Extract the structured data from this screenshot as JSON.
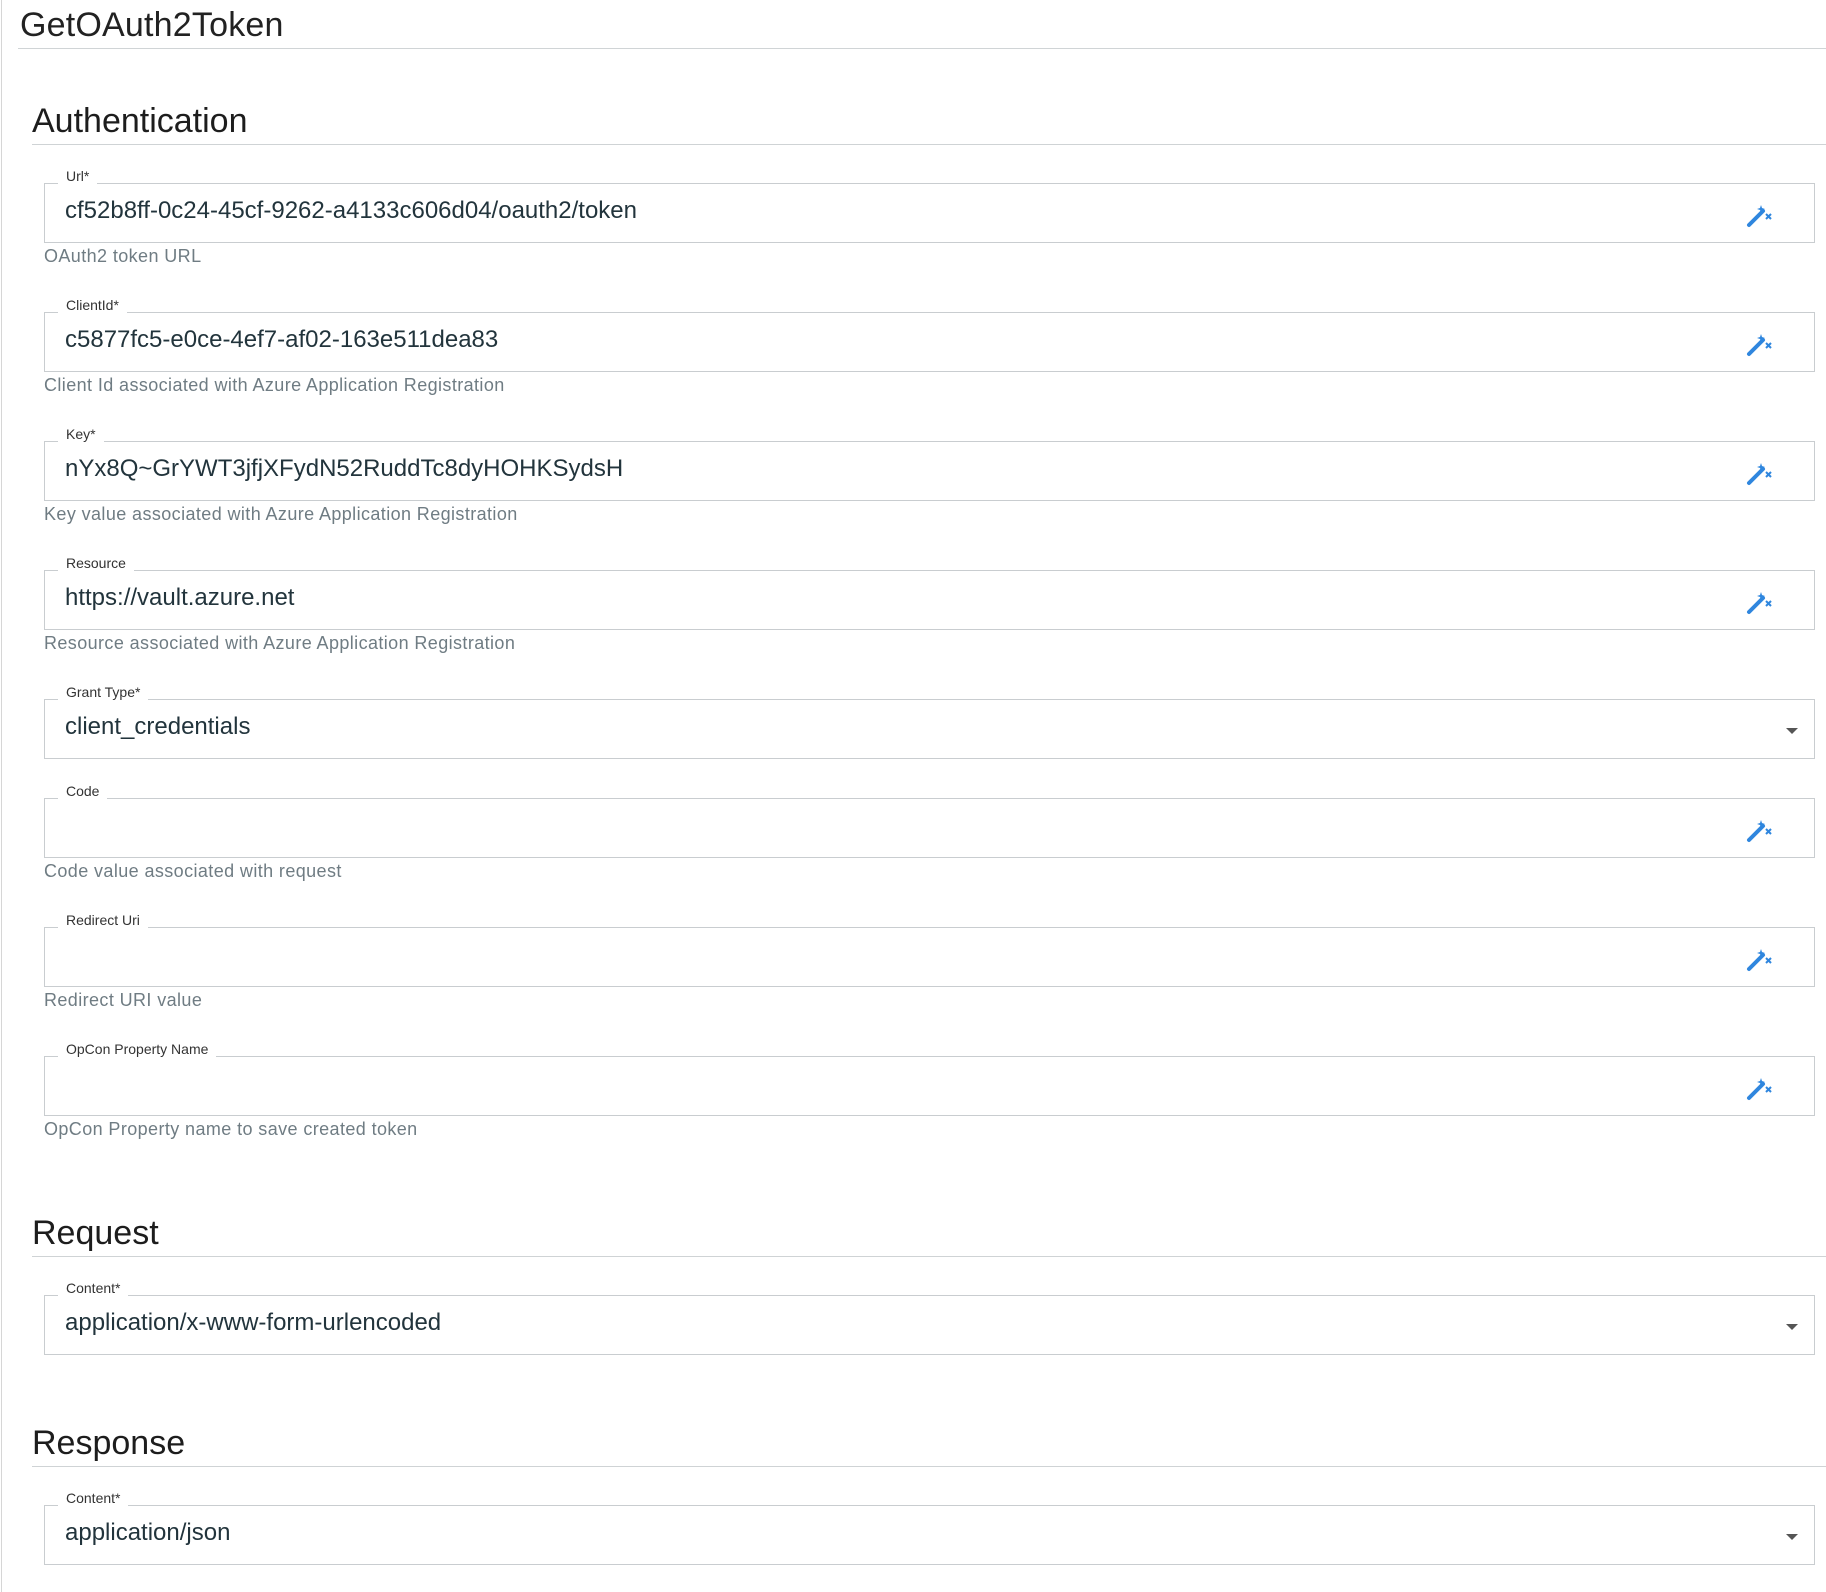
{
  "header": {
    "title": "GetOAuth2Token"
  },
  "sections": {
    "authentication": "Authentication",
    "request": "Request",
    "response": "Response"
  },
  "fields": {
    "url": {
      "label": "Url*",
      "value": "cf52b8ff-0c24-45cf-9262-a4133c606d04/oauth2/token",
      "helper": "OAuth2 token URL"
    },
    "client_id": {
      "label": "ClientId*",
      "value": "c5877fc5-e0ce-4ef7-af02-163e511dea83",
      "helper": "Client Id associated with Azure Application Registration"
    },
    "key": {
      "label": "Key*",
      "value": "nYx8Q~GrYWT3jfjXFydN52RuddTc8dyHOHKSydsH",
      "helper": "Key value associated with Azure Application Registration"
    },
    "resource": {
      "label": "Resource",
      "value": "https://vault.azure.net",
      "helper": "Resource associated with Azure Application Registration"
    },
    "grant_type": {
      "label": "Grant Type*",
      "value": "client_credentials"
    },
    "code": {
      "label": "Code",
      "value": "",
      "helper": "Code value associated with request"
    },
    "redirect_uri": {
      "label": "Redirect Uri",
      "value": "",
      "helper": "Redirect URI value"
    },
    "opcon_property": {
      "label": "OpCon Property Name",
      "value": "",
      "helper": "OpCon Property name to save created token"
    },
    "request_content": {
      "label": "Content*",
      "value": "application/x-www-form-urlencoded"
    },
    "response_content": {
      "label": "Content*",
      "value": "application/json"
    }
  },
  "icons": {
    "wand": "magic-wand-icon",
    "dropdown": "chevron-down-icon"
  },
  "colors": {
    "accent": "#2f86de",
    "text": "#22343c",
    "helper": "#6f7c83",
    "border": "#c9cdd0"
  }
}
